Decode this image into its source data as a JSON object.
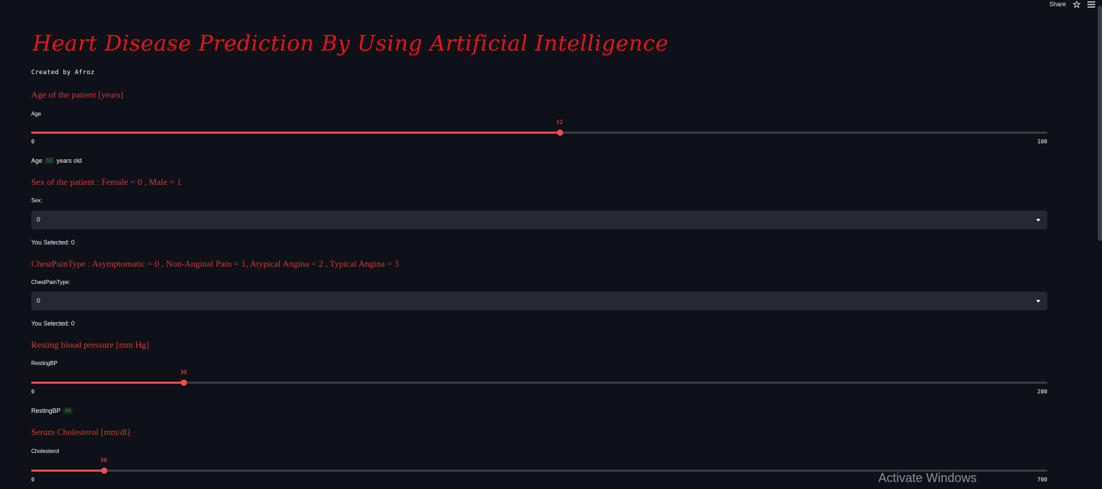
{
  "topbar": {
    "share_label": "Share"
  },
  "header": {
    "title": "Heart Disease Prediction By Using Artificial Intelligence",
    "subtitle": "Created by Afroz"
  },
  "age": {
    "heading": "Age of the patient [years]",
    "label": "Age",
    "value": 52,
    "min": 0,
    "max": 100,
    "value_text": "52",
    "min_text": "0",
    "max_text": "100",
    "readout_prefix": "Age",
    "readout_suffix": "years old"
  },
  "sex": {
    "heading": "Sex of the patient : Female = 0 , Male = 1",
    "label": "Sex:",
    "selected": "0",
    "selected_text": "You Selected: 0"
  },
  "chest_pain": {
    "heading": "ChestPainType : Asymptomatic = 0 , Non-Anginal Pain = 1, Atypical Angina = 2 , Typical Angina = 3",
    "label": "ChestPainType:",
    "selected": "0",
    "selected_text": "You Selected: 0"
  },
  "resting_bp": {
    "heading": "Resting blood pressure [mm Hg]",
    "label": "RestingBP",
    "value": 30,
    "min": 0,
    "max": 200,
    "value_text": "30",
    "min_text": "0",
    "max_text": "200",
    "readout_prefix": "RestingBP"
  },
  "cholesterol": {
    "heading": "Serum Cholesterol [mm/dl]",
    "label": "Cholesterol",
    "value": 50,
    "min": 0,
    "max": 700,
    "value_text": "50",
    "min_text": "0",
    "max_text": "700"
  },
  "watermark": "Activate Windows",
  "colors": {
    "accent": "#ff4b4b",
    "heading": "#d23a3a",
    "title": "#e8131f",
    "background": "#0e1117"
  }
}
